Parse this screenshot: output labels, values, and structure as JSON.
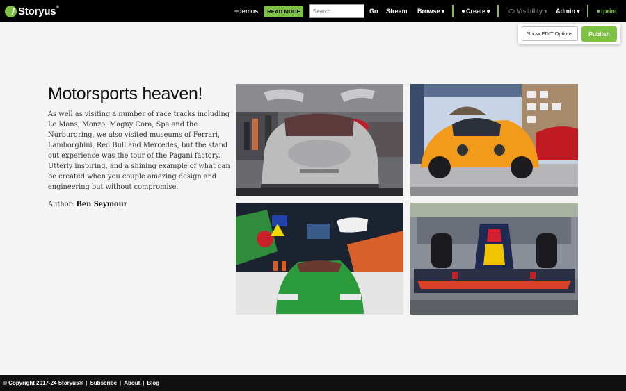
{
  "nav": {
    "logo_text": "Storyus",
    "logo_mark": "®",
    "demos": "+demos",
    "read_mode": "READ MODE",
    "search_placeholder": "Search",
    "go": "Go",
    "stream": "Stream",
    "browse": "Browse",
    "create": "Create",
    "visibility": "Visibility",
    "admin": "Admin",
    "user": "tprint",
    "accent_color": "#7dc242"
  },
  "edit_panel": {
    "show_edit": "Show EDIT Options",
    "publish": "Publish"
  },
  "story": {
    "title": "Motorsports heaven!",
    "body": "As well as visiting a number of race tracks including Le Mans, Monzo, Magny Cora, Spa and the Nurburgring, we also visited museums of Ferrari, Lamborghini, Red Bull and Mercedes, but the stand out experience was the tour of the Pagani factory. Utterly inspiring, and a shining example of what can be created when you couple amazing design and engineering but without compromise.",
    "author_label": "Author:",
    "author_name": "Ben Seymour",
    "photos": [
      {
        "subject": "silver gullwing sports car in museum"
      },
      {
        "subject": "orange hypercar on display"
      },
      {
        "subject": "green classic supercar under road signs"
      },
      {
        "subject": "red bull formula one car"
      }
    ]
  },
  "footer": {
    "copyright": "© Copyright 2017-24 Storyus®",
    "subscribe": "Subscribe",
    "about": "About",
    "blog": "Blog"
  }
}
